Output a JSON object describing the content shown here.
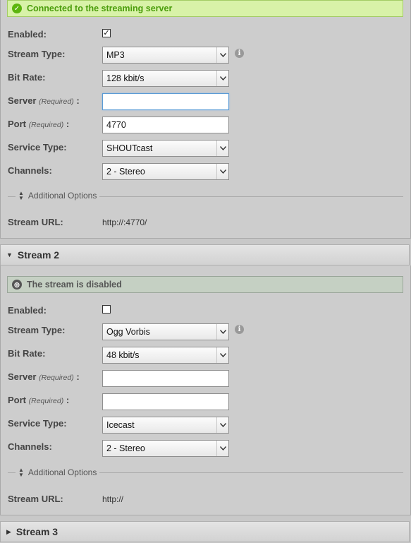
{
  "stream1": {
    "status": "Connected to the streaming server",
    "enabled_label": "Enabled:",
    "enabled_checked": true,
    "stream_type_label": "Stream Type:",
    "stream_type_value": "MP3",
    "bit_rate_label": "Bit Rate:",
    "bit_rate_value": "128 kbit/s",
    "server_label": "Server",
    "server_required": "(Required)",
    "server_colon": ":",
    "server_value": "",
    "port_label": "Port",
    "port_required": "(Required)",
    "port_colon": ":",
    "port_value": "4770",
    "service_type_label": "Service Type:",
    "service_type_value": "SHOUTcast",
    "channels_label": "Channels:",
    "channels_value": "2 - Stereo",
    "additional_options": "Additional Options",
    "stream_url_label": "Stream URL:",
    "stream_url_value": "http://:4770/"
  },
  "stream2": {
    "title": "Stream 2",
    "status": "The stream is disabled",
    "enabled_label": "Enabled:",
    "enabled_checked": false,
    "stream_type_label": "Stream Type:",
    "stream_type_value": "Ogg Vorbis",
    "bit_rate_label": "Bit Rate:",
    "bit_rate_value": "48 kbit/s",
    "server_label": "Server",
    "server_required": "(Required)",
    "server_colon": ":",
    "server_value": "",
    "port_label": "Port",
    "port_required": "(Required)",
    "port_colon": ":",
    "port_value": "",
    "service_type_label": "Service Type:",
    "service_type_value": "Icecast",
    "channels_label": "Channels:",
    "channels_value": "2 - Stereo",
    "additional_options": "Additional Options",
    "stream_url_label": "Stream URL:",
    "stream_url_value": "http://"
  },
  "stream3": {
    "title": "Stream 3"
  },
  "icons": {
    "check_mark": "✓",
    "info": "i",
    "expanded": "▼",
    "collapsed": "▶",
    "updown": "▲▼"
  },
  "colors": {
    "success_bg": "#d8f2a8",
    "success_text": "#4a9d0b",
    "disabled_bg": "#c5d0c3"
  }
}
